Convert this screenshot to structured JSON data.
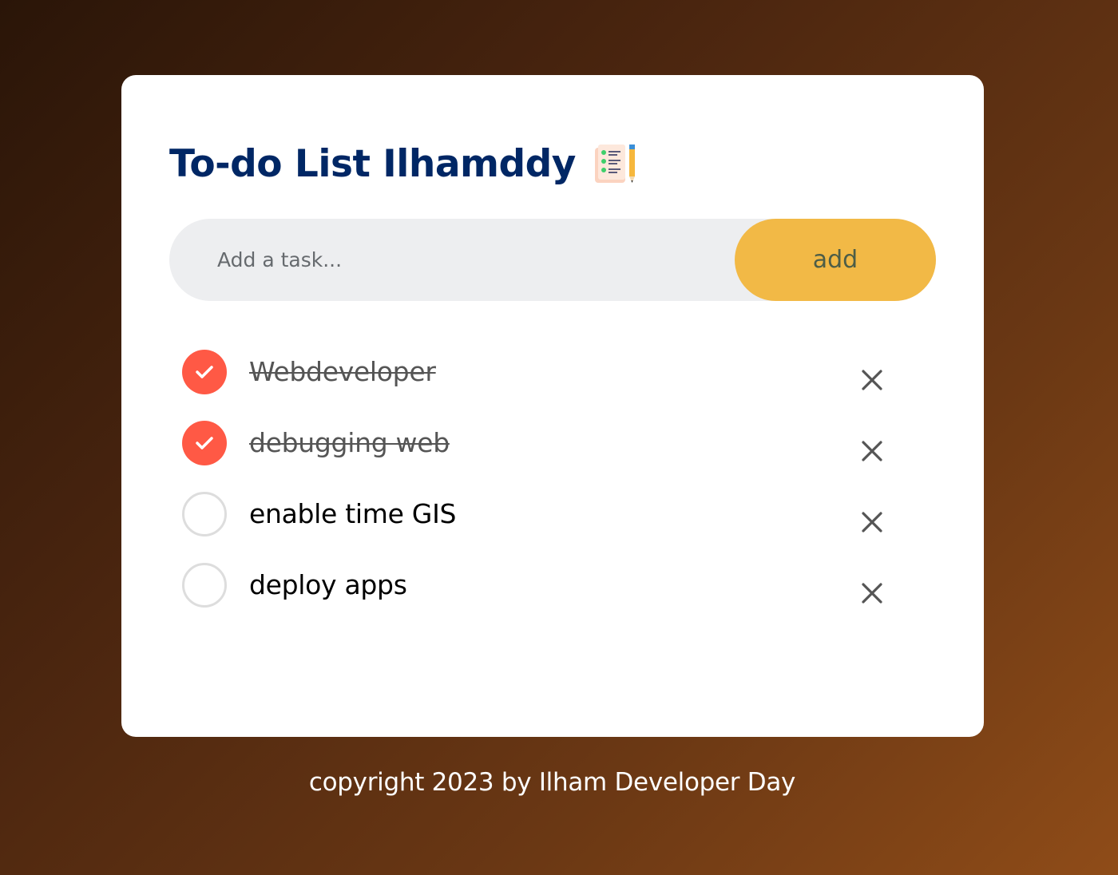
{
  "app": {
    "title": "To-do List Ilhamddy",
    "title_icon": "checklist-notepad-pencil-icon"
  },
  "input": {
    "placeholder": "Add a task...",
    "value": "",
    "add_label": "add"
  },
  "tasks": [
    {
      "text": "Webdeveloper",
      "done": true
    },
    {
      "text": "debugging web",
      "done": true
    },
    {
      "text": "enable time GIS",
      "done": false
    },
    {
      "text": "deploy apps",
      "done": false
    }
  ],
  "footer": {
    "text": "copyright 2023 by Ilham Developer Day"
  },
  "colors": {
    "title": "#002765",
    "accent_button": "#f2b946",
    "checked": "#ff5945",
    "input_bg": "#edeef0"
  }
}
